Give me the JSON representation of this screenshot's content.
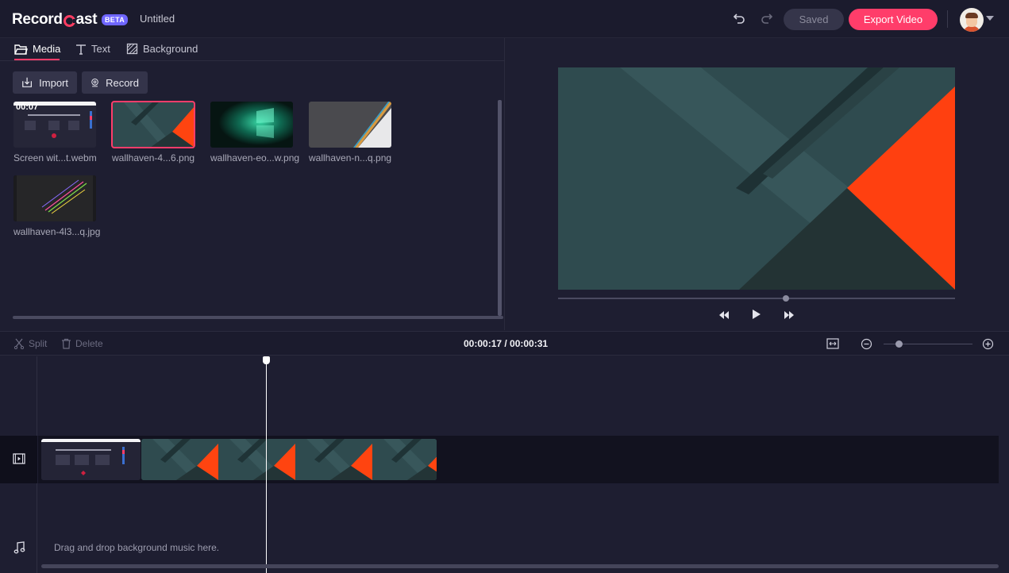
{
  "app": {
    "name_part1": "Record",
    "name_part2": "ast",
    "beta": "BETA",
    "doc_title": "Untitled"
  },
  "header": {
    "saved_label": "Saved",
    "export_label": "Export Video"
  },
  "tabs": [
    {
      "label": "Media",
      "icon": "folder-icon"
    },
    {
      "label": "Text",
      "icon": "text-icon"
    },
    {
      "label": "Background",
      "icon": "background-icon"
    }
  ],
  "actions": {
    "import_label": "Import",
    "record_label": "Record"
  },
  "media": [
    {
      "name": "Screen wit...t.webm",
      "duration": "00:07"
    },
    {
      "name": "wallhaven-4...6.png"
    },
    {
      "name": "wallhaven-eo...w.png"
    },
    {
      "name": "wallhaven-n...q.png"
    },
    {
      "name": "wallhaven-4l3...q.jpg"
    }
  ],
  "toolbar": {
    "split_label": "Split",
    "delete_label": "Delete",
    "timecode": "00:00:17 / 00:00:31"
  },
  "timeline": {
    "music_hint": "Drag and drop background music here."
  },
  "colors": {
    "accent": "#ff3d6a",
    "beta": "#6f66ff",
    "bg": "#1e1e31"
  }
}
